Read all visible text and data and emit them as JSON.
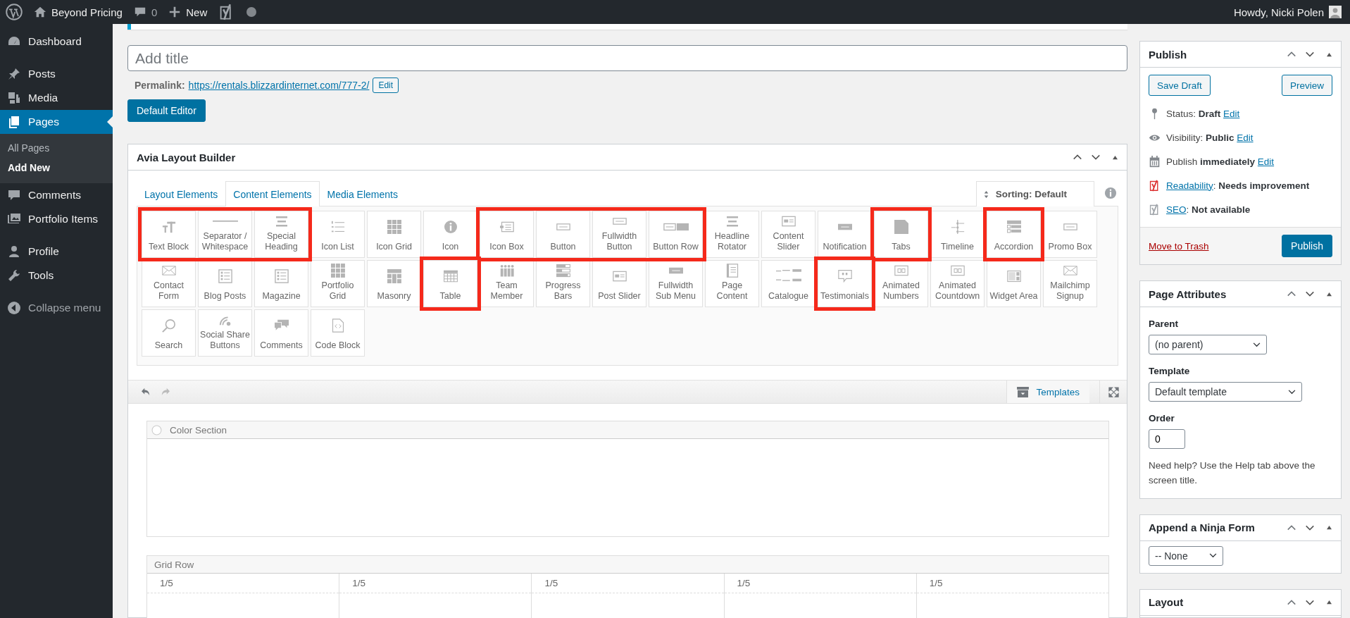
{
  "admin_bar": {
    "site": "Beyond Pricing",
    "comments": "0",
    "new": "New",
    "greeting": "Howdy, Nicki Polen"
  },
  "sidebar": {
    "groups": [
      {
        "items": [
          {
            "kind": "dashboard",
            "label": "Dashboard",
            "selected": false
          }
        ]
      },
      {
        "items": [
          {
            "kind": "pin",
            "label": "Posts",
            "selected": false
          },
          {
            "kind": "media",
            "label": "Media",
            "selected": false
          },
          {
            "kind": "pages",
            "label": "Pages",
            "selected": true,
            "children": [
              {
                "label": "All Pages",
                "selected": false
              },
              {
                "label": "Add New",
                "selected": true
              }
            ]
          },
          {
            "kind": "comment",
            "label": "Comments",
            "selected": false
          },
          {
            "kind": "portfolio",
            "label": "Portfolio Items",
            "selected": false
          }
        ]
      },
      {
        "items": [
          {
            "kind": "user",
            "label": "Profile",
            "selected": false
          },
          {
            "kind": "wrench",
            "label": "Tools",
            "selected": false
          }
        ]
      }
    ],
    "collapse": "Collapse menu"
  },
  "editor": {
    "title_placeholder": "Add title",
    "permalink_label": "Permalink:",
    "permalink_url": "https://rentals.blizzardinternet.com/777-2/",
    "permalink_edit": "Edit",
    "default_editor": "Default Editor"
  },
  "builder": {
    "title": "Avia Layout Builder",
    "tabs": [
      {
        "label": "Layout Elements",
        "selected": false
      },
      {
        "label": "Content Elements",
        "selected": true
      },
      {
        "label": "Media Elements",
        "selected": false
      }
    ],
    "sorting": "Sorting: Default",
    "rows": [
      {
        "groups": [
          {
            "highlighted": true,
            "items": [
              {
                "kind": "text",
                "label": "Text Block"
              },
              {
                "kind": "line",
                "label": "Separator / Whitespace"
              },
              {
                "kind": "lines",
                "label": "Special Heading"
              }
            ]
          },
          {
            "highlighted": false,
            "items": [
              {
                "kind": "list",
                "label": "Icon List"
              },
              {
                "kind": "grid",
                "label": "Icon Grid"
              },
              {
                "kind": "info",
                "label": "Icon"
              }
            ]
          },
          {
            "highlighted": true,
            "items": [
              {
                "kind": "iconbox",
                "label": "Icon Box"
              },
              {
                "kind": "button",
                "label": "Button"
              },
              {
                "kind": "button",
                "label": "Fullwidth Button"
              },
              {
                "kind": "buttons",
                "label": "Button Row"
              }
            ]
          },
          {
            "highlighted": false,
            "items": [
              {
                "kind": "lines",
                "label": "Headline Rotator"
              },
              {
                "kind": "slider",
                "label": "Content Slider"
              },
              {
                "kind": "bar",
                "label": "Notification"
              }
            ]
          },
          {
            "highlighted": true,
            "items": [
              {
                "kind": "tab",
                "label": "Tabs"
              }
            ]
          },
          {
            "highlighted": false,
            "items": [
              {
                "kind": "timeline",
                "label": "Timeline"
              }
            ]
          },
          {
            "highlighted": true,
            "items": [
              {
                "kind": "accordion",
                "label": "Accordion"
              }
            ]
          },
          {
            "highlighted": false,
            "items": [
              {
                "kind": "button",
                "label": "Promo Box"
              }
            ]
          }
        ]
      },
      {
        "groups": [
          {
            "highlighted": false,
            "items": [
              {
                "kind": "envelope",
                "label": "Contact Form"
              },
              {
                "kind": "document",
                "label": "Blog Posts"
              },
              {
                "kind": "document",
                "label": "Magazine"
              },
              {
                "kind": "squares",
                "label": "Portfolio Grid"
              },
              {
                "kind": "masonry",
                "label": "Masonry"
              }
            ]
          },
          {
            "highlighted": true,
            "items": [
              {
                "kind": "table",
                "label": "Table"
              }
            ]
          },
          {
            "highlighted": false,
            "items": [
              {
                "kind": "people",
                "label": "Team Member"
              },
              {
                "kind": "bars",
                "label": "Progress Bars"
              },
              {
                "kind": "slider",
                "label": "Post Slider"
              },
              {
                "kind": "bar",
                "label": "Fullwidth Sub Menu"
              },
              {
                "kind": "page",
                "label": "Page Content"
              },
              {
                "kind": "price",
                "label": "Catalogue"
              }
            ]
          },
          {
            "highlighted": true,
            "items": [
              {
                "kind": "quote",
                "label": "Testimonials"
              }
            ]
          },
          {
            "highlighted": false,
            "items": [
              {
                "kind": "number",
                "label": "Animated Numbers"
              },
              {
                "kind": "number",
                "label": "Animated Countdown"
              },
              {
                "kind": "widget",
                "label": "Widget Area"
              },
              {
                "kind": "envelope",
                "label": "Mailchimp Signup"
              }
            ]
          }
        ]
      },
      {
        "groups": [
          {
            "highlighted": false,
            "items": [
              {
                "kind": "search",
                "label": "Search"
              },
              {
                "kind": "signal",
                "label": "Social Share Buttons"
              },
              {
                "kind": "chat",
                "label": "Comments"
              },
              {
                "kind": "code",
                "label": "Code Block"
              }
            ]
          }
        ]
      }
    ],
    "templates": "Templates",
    "sections": [
      {
        "kind": "color_section",
        "title": "Color Section"
      },
      {
        "kind": "grid_row",
        "title": "Grid Row",
        "cells": [
          "1/5",
          "1/5",
          "1/5",
          "1/5",
          "1/5"
        ]
      }
    ]
  },
  "publish": {
    "title": "Publish",
    "save_draft": "Save Draft",
    "preview": "Preview",
    "rows": [
      {
        "kind": "pin",
        "parts": [
          {
            "kind": "text",
            "text": "Status: **Draft** "
          },
          {
            "kind": "link",
            "text": "Edit"
          }
        ]
      },
      {
        "kind": "eye",
        "parts": [
          {
            "kind": "text",
            "text": "Visibility: **Public** "
          },
          {
            "kind": "link",
            "text": "Edit"
          }
        ]
      },
      {
        "kind": "calendar",
        "parts": [
          {
            "kind": "text",
            "text": "Publish **immediately** "
          },
          {
            "kind": "link",
            "text": "Edit"
          }
        ]
      },
      {
        "kind": "yoast",
        "color": "#dc3232",
        "parts": [
          {
            "kind": "link",
            "text": "Readability"
          },
          {
            "kind": "text",
            "text": ": **Needs improvement**"
          }
        ]
      },
      {
        "kind": "yoast",
        "color": "#a0a5aa",
        "parts": [
          {
            "kind": "link",
            "text": "SEO"
          },
          {
            "kind": "text",
            "text": ": **Not available**"
          }
        ]
      }
    ],
    "trash": "Move to Trash",
    "publish": "Publish"
  },
  "page_attributes": {
    "title": "Page Attributes",
    "parent_label": "Parent",
    "parent": "(no parent)",
    "template_label": "Template",
    "template": "Default template",
    "order_label": "Order",
    "order": "0",
    "help": "Need help? Use the Help tab above the screen title."
  },
  "ninja_form": {
    "title": "Append a Ninja Form",
    "value": "-- None"
  },
  "layout": {
    "title": "Layout"
  }
}
